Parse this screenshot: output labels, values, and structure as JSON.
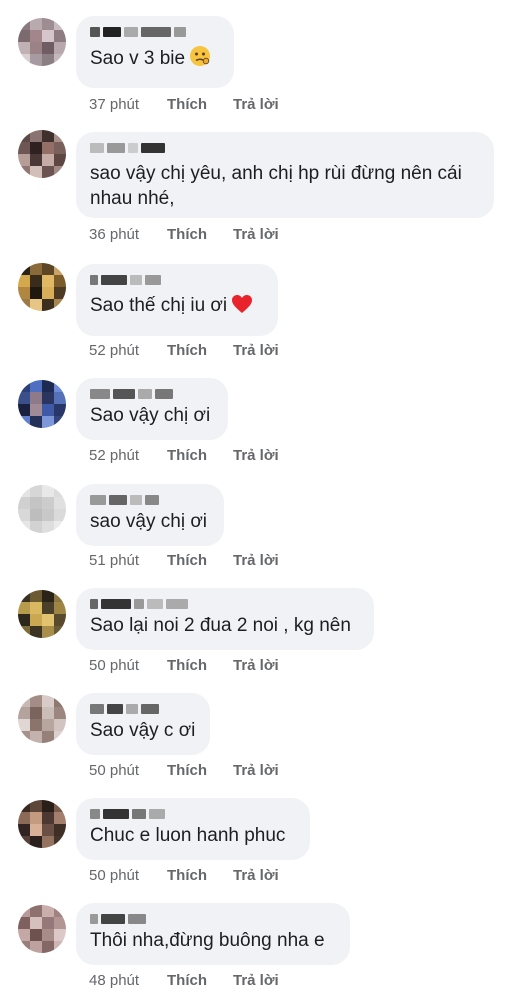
{
  "comments": [
    {
      "text": "Sao v 3 bie",
      "emoji": "confused-face-icon",
      "time": "37 phút",
      "like": "Thích",
      "reply": "Trả lời"
    },
    {
      "text": "sao vậy chị yêu, anh chị hp rùi đừng nên cái nhau nhé,",
      "time": "36 phút",
      "like": "Thích",
      "reply": "Trả lời"
    },
    {
      "text": "Sao thế chị iu ơi",
      "emoji": "red-heart-icon",
      "time": "52 phút",
      "like": "Thích",
      "reply": "Trả lời"
    },
    {
      "text": "Sao vậy chị ơi",
      "time": "52 phút",
      "like": "Thích",
      "reply": "Trả lời"
    },
    {
      "text": "sao vậy chị ơi",
      "time": "51 phút",
      "like": "Thích",
      "reply": "Trả lời"
    },
    {
      "text": "Sao lại noi 2 đua 2 noi , kg nên",
      "time": "50 phút",
      "like": "Thích",
      "reply": "Trả lời"
    },
    {
      "text": "Sao vậy c ơi",
      "time": "50 phút",
      "like": "Thích",
      "reply": "Trả lời"
    },
    {
      "text": "Chuc e luon hanh phuc",
      "time": "50 phút",
      "like": "Thích",
      "reply": "Trả lời"
    },
    {
      "text": "Thôi nha,đừng buông nha e",
      "time": "48 phút",
      "like": "Thích",
      "reply": "Trả lời"
    }
  ],
  "colors": {
    "bubble": "#f0f2f5",
    "text": "#1c1e21",
    "meta": "#65676b"
  }
}
